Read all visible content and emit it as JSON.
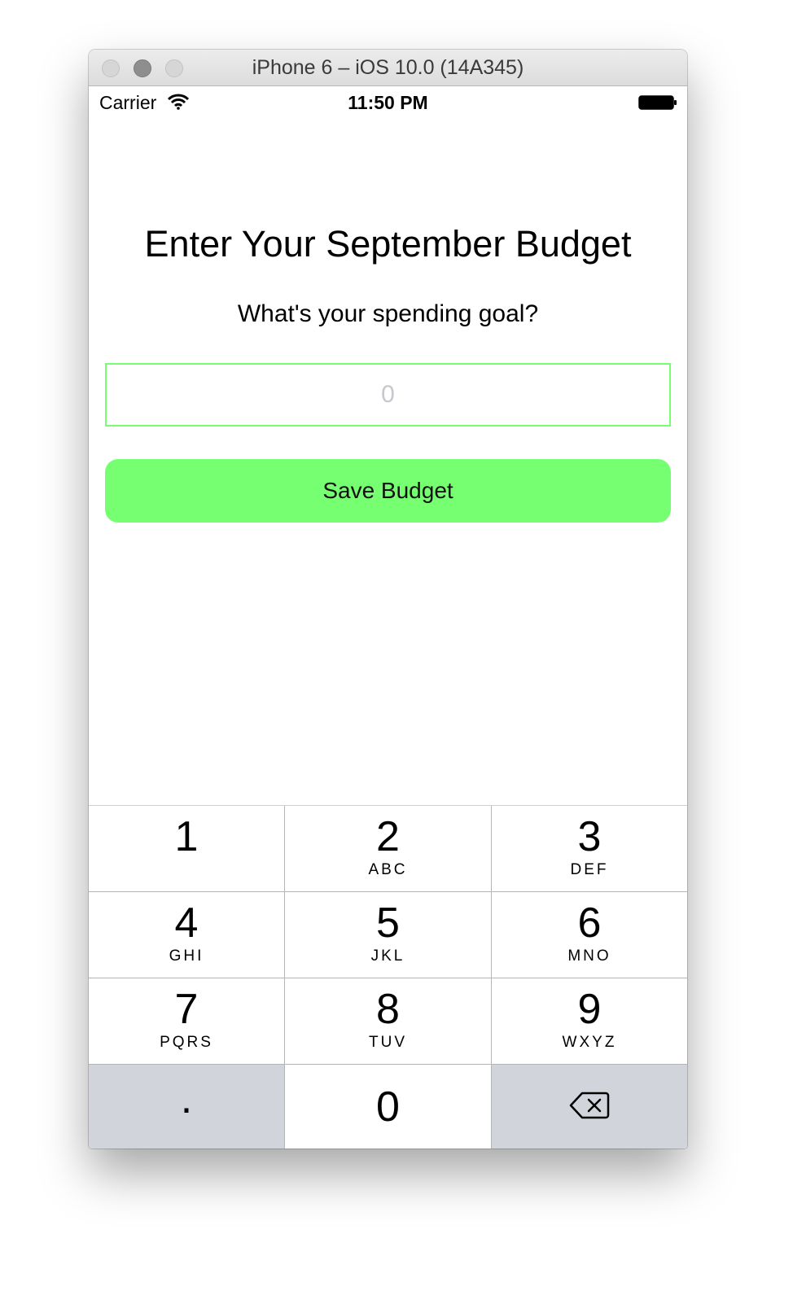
{
  "window": {
    "title": "iPhone 6 – iOS 10.0 (14A345)"
  },
  "status_bar": {
    "carrier": "Carrier",
    "time": "11:50 PM",
    "icons": [
      "wifi-icon",
      "battery-icon"
    ]
  },
  "main": {
    "heading": "Enter Your September Budget",
    "subheading": "What's your spending goal?",
    "budget_input": {
      "value": "",
      "placeholder": "0"
    },
    "save_button_label": "Save Budget",
    "accent_color": "#77ff72"
  },
  "keypad": {
    "keys": [
      {
        "digit": "1",
        "letters": ""
      },
      {
        "digit": "2",
        "letters": "ABC"
      },
      {
        "digit": "3",
        "letters": "DEF"
      },
      {
        "digit": "4",
        "letters": "GHI"
      },
      {
        "digit": "5",
        "letters": "JKL"
      },
      {
        "digit": "6",
        "letters": "MNO"
      },
      {
        "digit": "7",
        "letters": "PQRS"
      },
      {
        "digit": "8",
        "letters": "TUV"
      },
      {
        "digit": "9",
        "letters": "WXYZ"
      }
    ],
    "decimal": ".",
    "zero": "0",
    "backspace_icon": "backspace-icon"
  }
}
